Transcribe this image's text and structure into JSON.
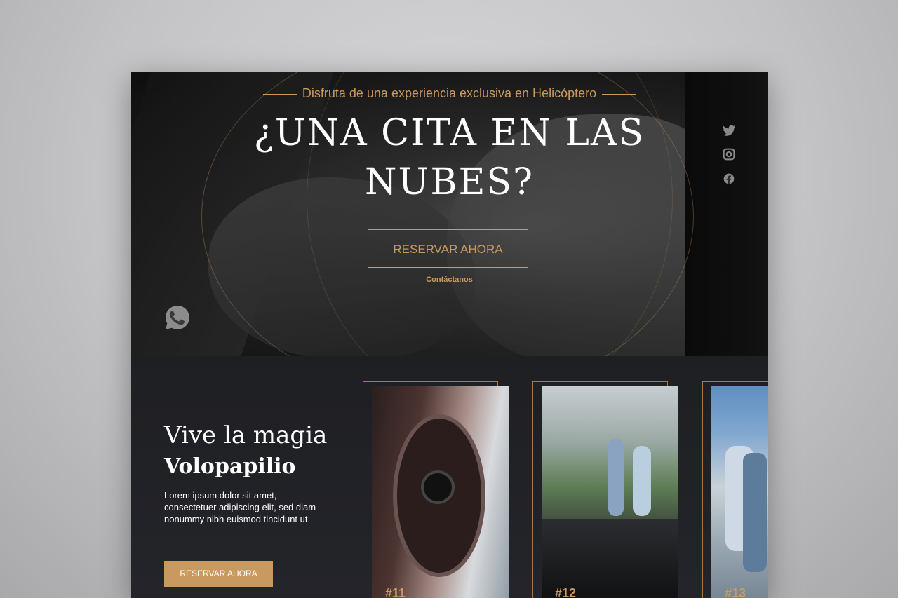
{
  "hero": {
    "eyebrow": "Disfruta de una experiencia exclusiva en Helicóptero",
    "headline_line1": "¿UNA CITA EN LAS",
    "headline_line2": "NUBES?",
    "cta_label": "RESERVAR AHORA",
    "contact_label": "Contáctanos"
  },
  "social": [
    "twitter-icon",
    "instagram-icon",
    "facebook-icon"
  ],
  "whatsapp": "whatsapp-icon",
  "section": {
    "title": "Vive la magia",
    "subtitle": "Volopapilio",
    "text": "Lorem ipsum dolor sit amet, consectetuer adipiscing elit, sed diam nonummy nibh euismod tincidunt ut.",
    "cta_label": "RESERVAR AHORA"
  },
  "cards": [
    {
      "label": "#11"
    },
    {
      "label": "#12"
    },
    {
      "label": "#13"
    }
  ],
  "colors": {
    "accent": "#c9995f",
    "dark": "#1c1c1f",
    "text": "#ffffff"
  }
}
